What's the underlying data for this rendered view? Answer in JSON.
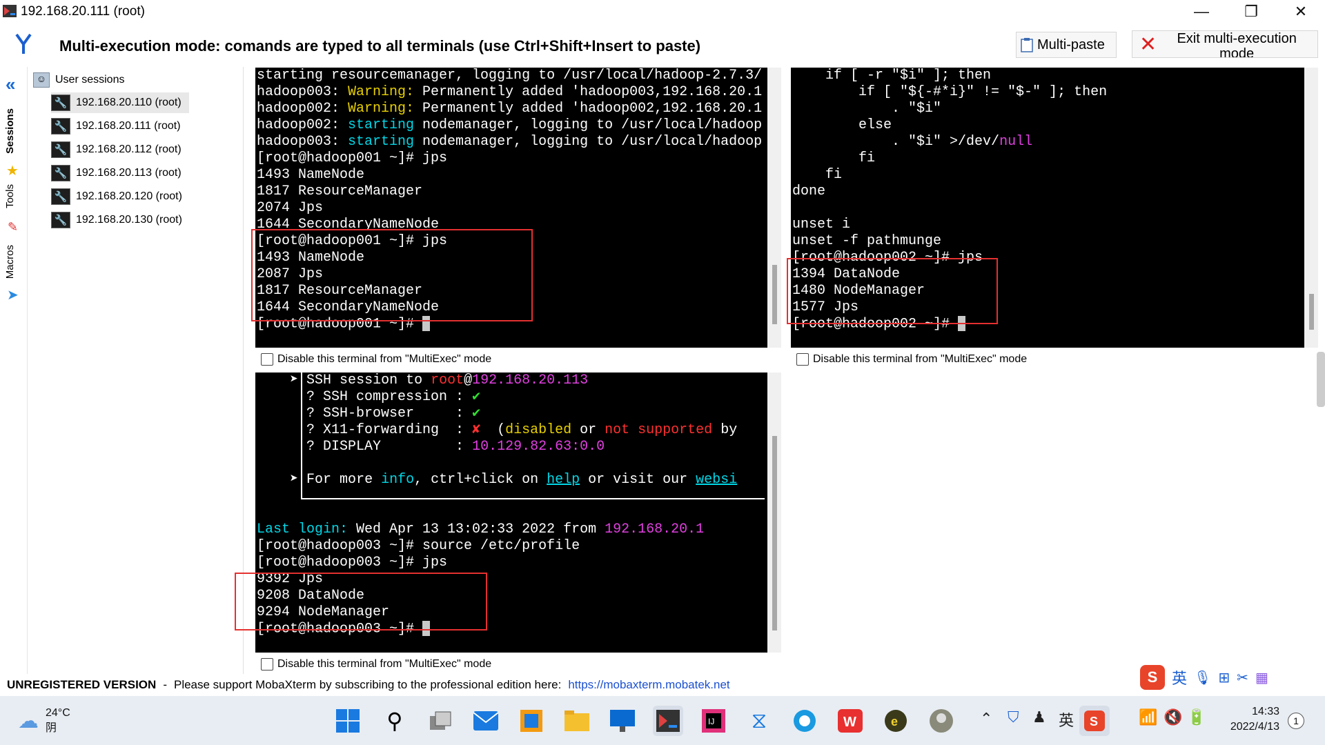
{
  "window": {
    "title": "192.168.20.111 (root)"
  },
  "header": {
    "mode_text": "Multi-execution mode: comands are typed to all terminals (use Ctrl+Shift+Insert to paste)",
    "multipaste_label": "Multi-paste",
    "exit_label": "Exit multi-execution mode"
  },
  "sidebar": {
    "tabs": [
      "Sessions",
      "Tools",
      "Macros"
    ]
  },
  "sessions": {
    "root_label": "User sessions",
    "items": [
      "192.168.20.110 (root)",
      "192.168.20.111 (root)",
      "192.168.20.112 (root)",
      "192.168.20.113 (root)",
      "192.168.20.120 (root)",
      "192.168.20.130 (root)"
    ]
  },
  "terminals": {
    "t1": [
      "starting resourcemanager, logging to /usr/local/hadoop-2.7.3/",
      "hadoop003: |Warning:| Permanently added 'hadoop003,192.168.20.1",
      "hadoop002: |Warning:| Permanently added 'hadoop002,192.168.20.1",
      "hadoop002: |starting| nodemanager, logging to /usr/local/hadoop",
      "hadoop003: |starting| nodemanager, logging to /usr/local/hadoop",
      "[root@hadoop001 ~]# jps",
      "1493 NameNode",
      "1817 ResourceManager",
      "2074 Jps",
      "1644 SecondaryNameNode",
      "[root@hadoop001 ~]# jps",
      "1493 NameNode",
      "2087 Jps",
      "1817 ResourceManager",
      "1644 SecondaryNameNode",
      "[root@hadoop001 ~]# "
    ],
    "t2": [
      "    if [ -r \"$i\" ]; then",
      "        if [ \"${-#*i}\" != \"$-\" ]; then",
      "            . \"$i\"",
      "        else",
      "            . \"$i\" >/dev/null",
      "        fi",
      "    fi",
      "done",
      "",
      "unset i",
      "unset -f pathmunge",
      "[root@hadoop002 ~]# jps",
      "1394 DataNode",
      "1480 NodeManager",
      "1577 Jps",
      "[root@hadoop002 ~]# "
    ],
    "t3": [
      "    ➤ SSH session to root@192.168.20.113",
      "      ? SSH compression : ✔",
      "      ? SSH-browser     : ✔",
      "      ? X11-forwarding  : ✘  (disabled or not supported by",
      "      ? DISPLAY         : 10.129.82.63:0.0",
      "",
      "    ➤ For more info, ctrl+click on help or visit our websi",
      "",
      "",
      "Last login: Wed Apr 13 13:02:33 2022 from 192.168.20.1",
      "[root@hadoop003 ~]# source /etc/profile",
      "[root@hadoop003 ~]# jps",
      "9392 Jps",
      "9208 DataNode",
      "9294 NodeManager",
      "[root@hadoop003 ~]# "
    ]
  },
  "checkbox_label": "Disable this terminal from \"MultiExec\" mode",
  "status": {
    "unregistered": "UNREGISTERED VERSION",
    "dash": "-",
    "message": "Please support MobaXterm by subscribing to the professional edition here:",
    "link": "https://mobaxterm.mobatek.net"
  },
  "taskbar": {
    "weather_temp": "24°C",
    "weather_desc": "阴",
    "ime": "英",
    "time": "14:33",
    "date": "2022/4/13",
    "notifications": "1",
    "ime_toolbar": "英"
  },
  "colors": {
    "terminal_bg": "#000000",
    "highlight_box": "#e53030",
    "accent_blue": "#0050c8"
  }
}
